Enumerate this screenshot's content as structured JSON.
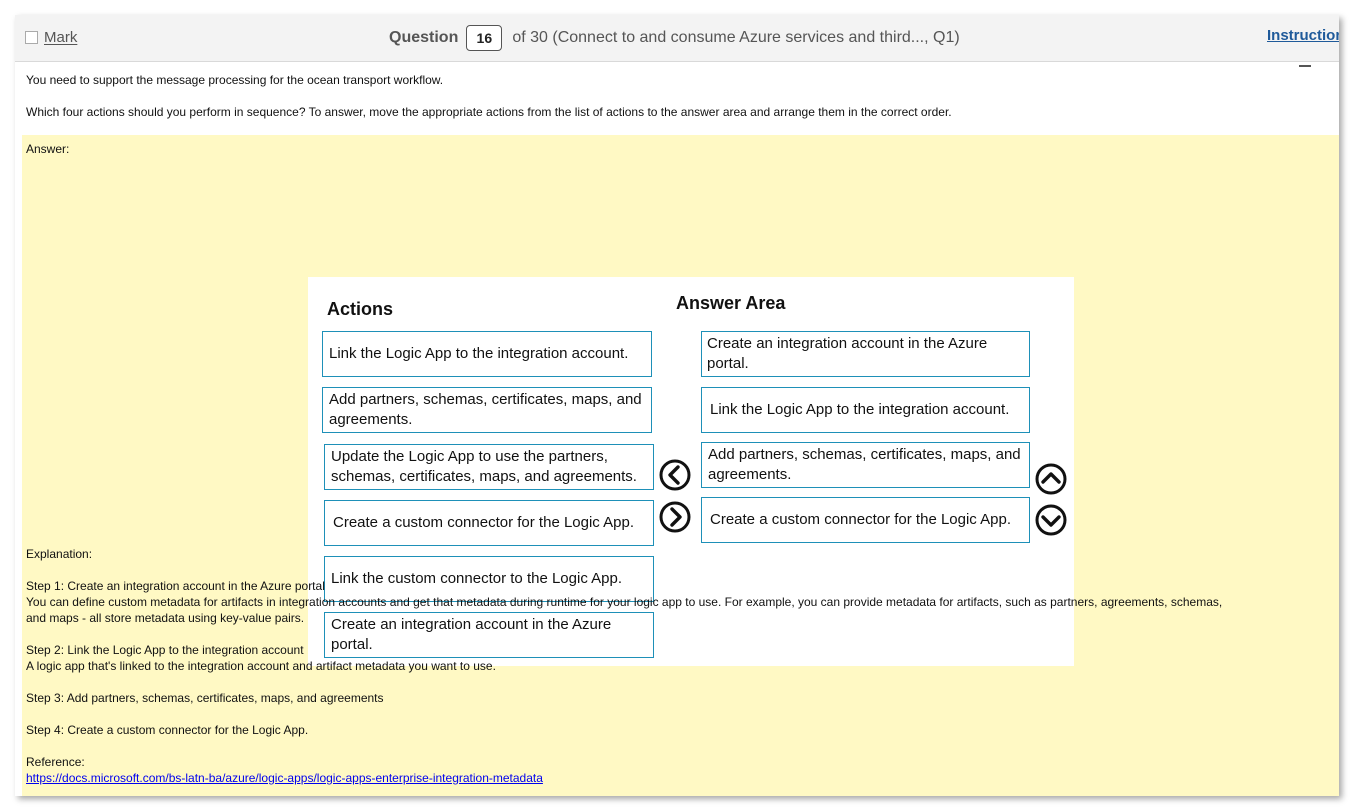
{
  "header": {
    "mark_label": "Mark",
    "question_label": "Question",
    "question_number": "16",
    "question_suffix": "of 30 (Connect to and consume Azure services and third..., Q1)",
    "instructions_label": "Instructions"
  },
  "question": {
    "intro": "You need to support the message processing for the ocean transport workflow.",
    "prompt": "Which four actions should you perform in sequence? To answer, move the appropriate actions from the list of actions to the answer area and arrange them in the correct order."
  },
  "answer_label": "Answer:",
  "dragdrop": {
    "actions_title": "Actions",
    "answer_title": "Answer Area",
    "actions": [
      "Link the Logic App to the integration account.",
      "Add partners, schemas, certificates, maps, and agreements.",
      "Update the Logic App to use the partners, schemas, certificates, maps, and agreements.",
      "Create a custom connector for the Logic App.",
      "Link the custom connector to the Logic App.",
      "Create an integration account in the Azure portal."
    ],
    "answers": [
      "Create an integration account in the Azure portal.",
      "Link the Logic App to the integration account.",
      "Add partners, schemas, certificates, maps, and agreements.",
      "Create a custom connector for the Logic App."
    ],
    "icons": {
      "move_left": "chevron-left-circle-icon",
      "move_right": "chevron-right-circle-icon",
      "move_up": "chevron-up-circle-icon",
      "move_down": "chevron-down-circle-icon"
    }
  },
  "explanation": {
    "label": "Explanation:",
    "step1_title": "Step 1: Create an integration account in the Azure portal",
    "step1_text_line1": "You can define custom metadata for artifacts in integration accounts and get that metadata during runtime for your logic app to use. For example, you can provide metadata for artifacts, such as partners, agreements, schemas,",
    "step1_text_line2": "and maps - all store metadata using key-value pairs.",
    "step2_title": "Step 2: Link the Logic App to the integration account",
    "step2_text": "A logic app that's linked to the integration account and artifact metadata you want to use.",
    "step3_title": "Step 3: Add partners, schemas, certificates, maps, and agreements",
    "step4_title": "Step 4: Create a custom connector for the Logic App.",
    "reference_label": "Reference:",
    "reference_url": "https://docs.microsoft.com/bs-latn-ba/azure/logic-apps/logic-apps-enterprise-integration-metadata"
  },
  "colors": {
    "answer_background": "#fff9c4",
    "box_border": "#1e90b8",
    "link": "#0000ee"
  }
}
